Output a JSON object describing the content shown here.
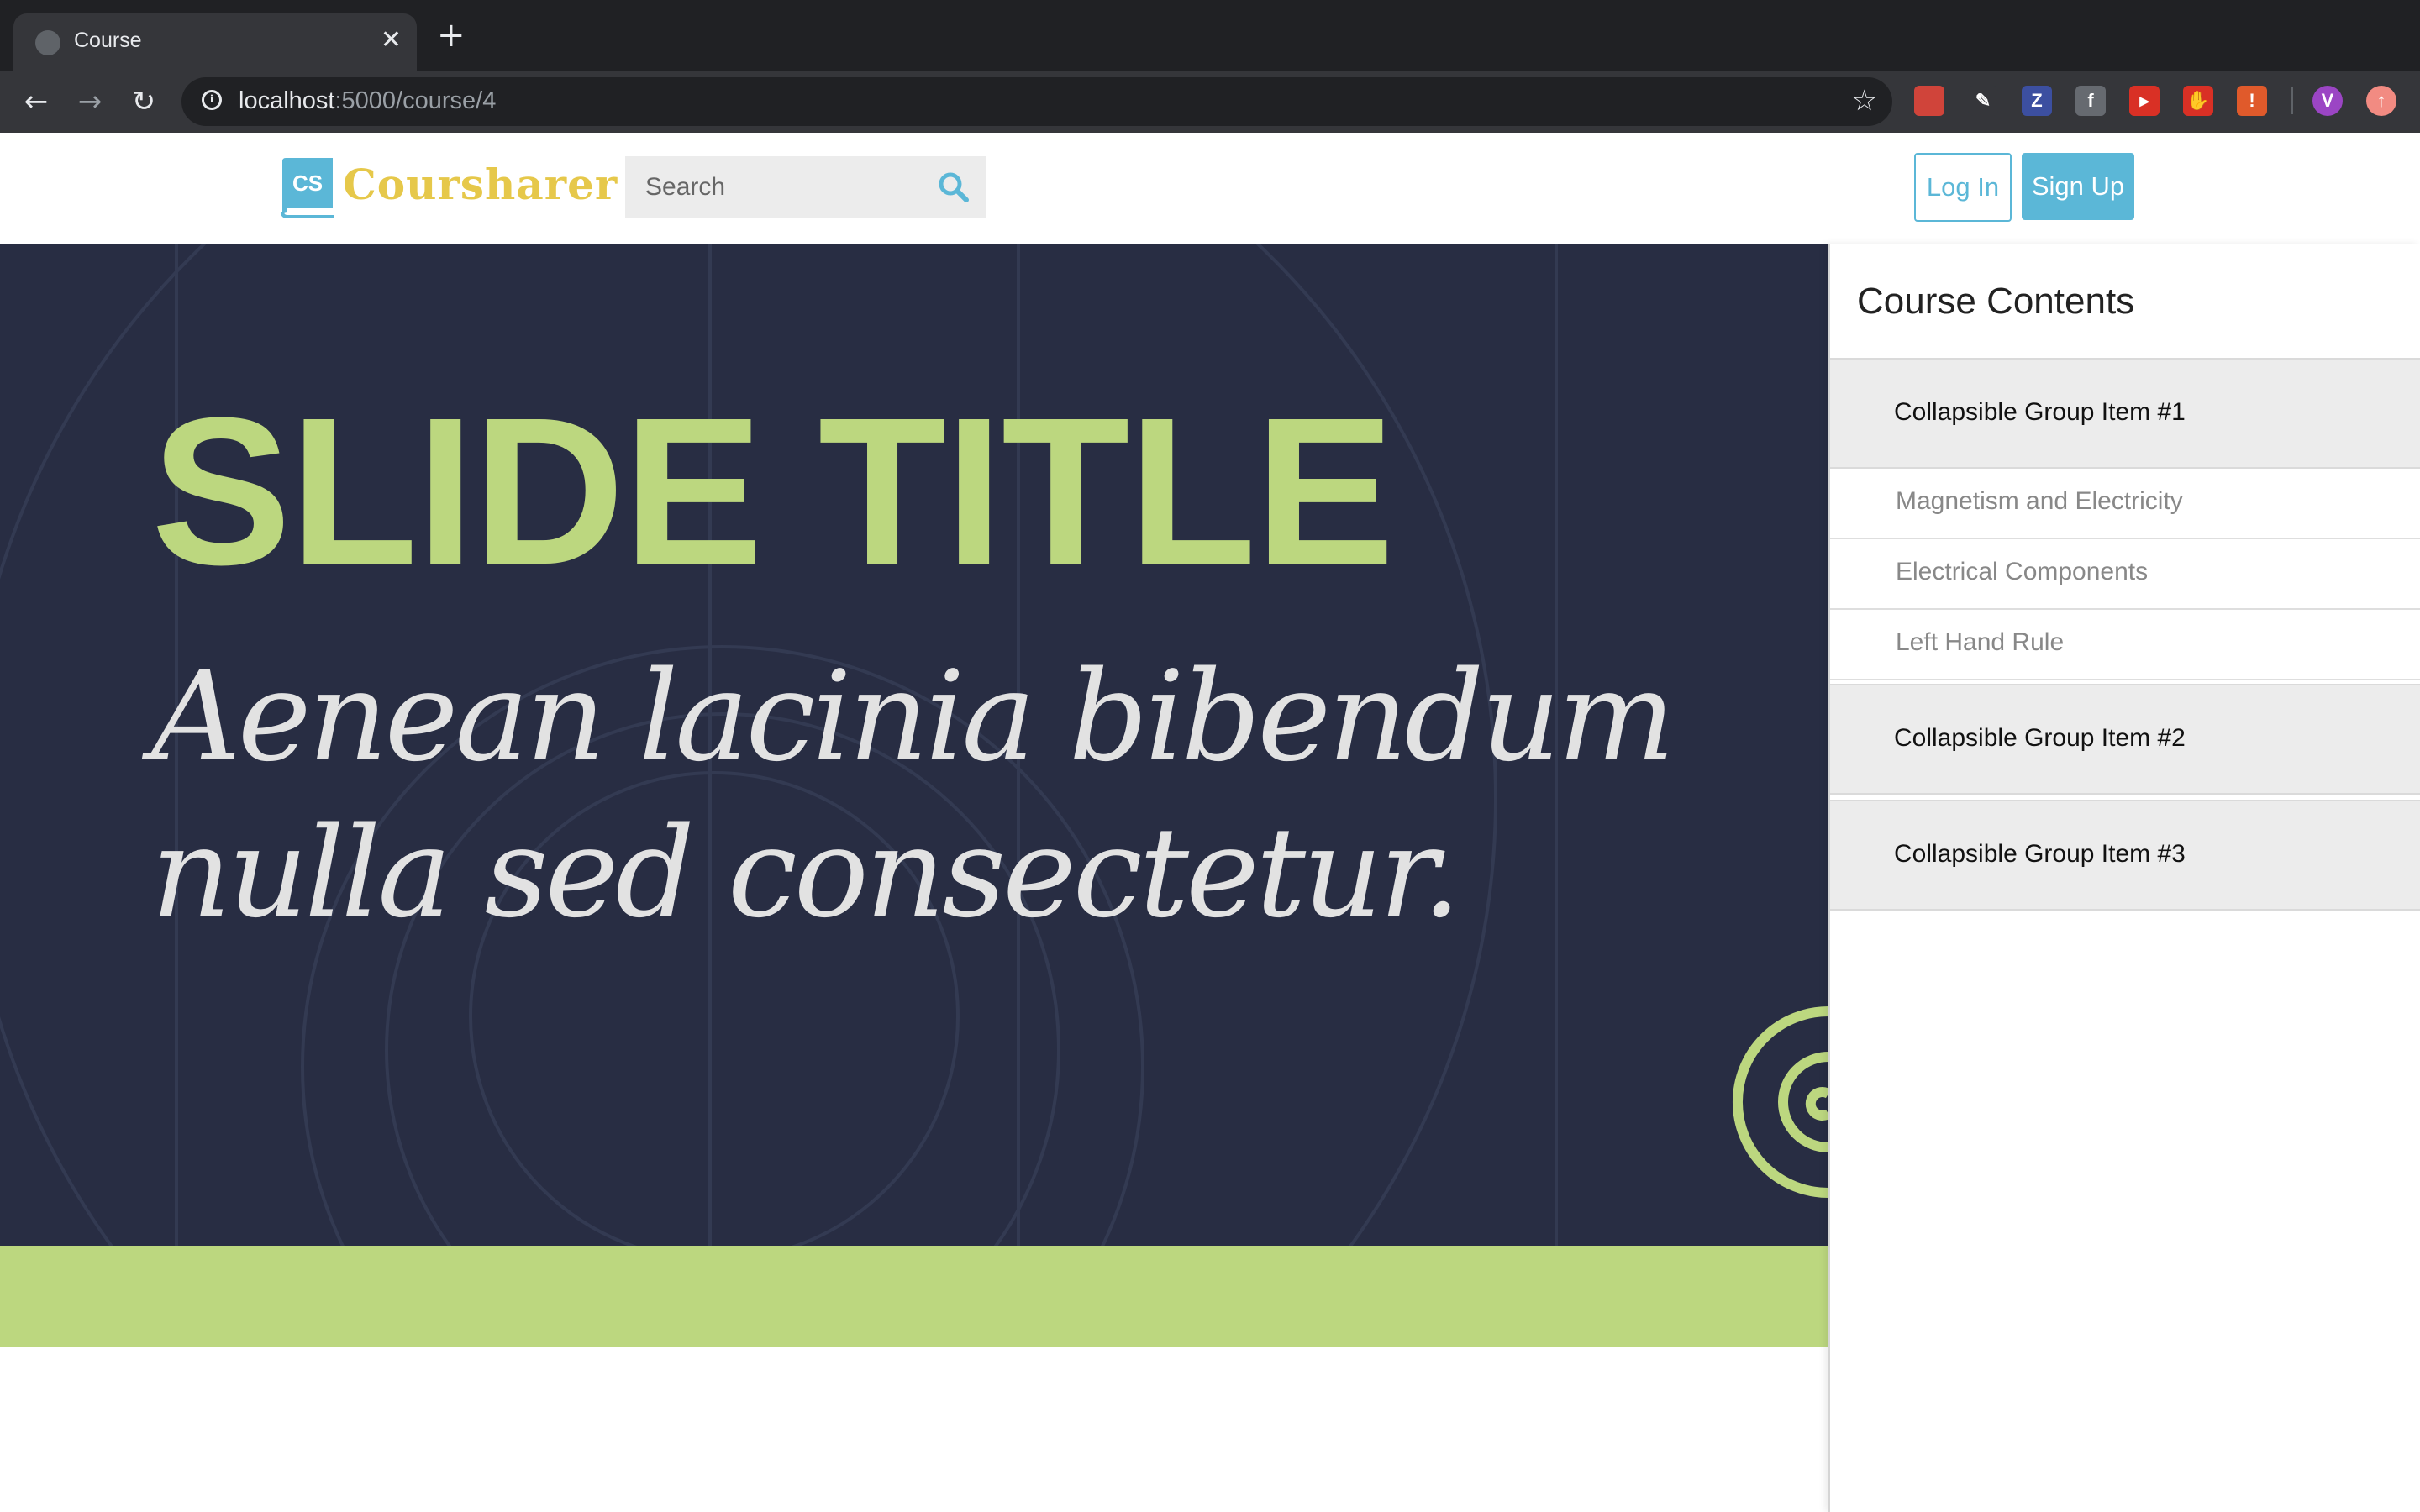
{
  "browser": {
    "tab_title": "Course",
    "tab_close": "✕",
    "new_tab": "+",
    "url_host": "localhost",
    "url_path": ":5000/course/4",
    "nav": {
      "back": "←",
      "forward": "→",
      "reload": "↻",
      "star": "☆"
    },
    "extensions": [
      {
        "icon": "pdf-extension-icon",
        "color": "#d0443a",
        "glyph": ""
      },
      {
        "icon": "highlighter-extension-icon",
        "color": "#35363a",
        "glyph": "✎"
      },
      {
        "icon": "zotero-extension-icon",
        "color": "#3c4fa0",
        "glyph": "Z"
      },
      {
        "icon": "facebook-extension-icon",
        "color": "#666a70",
        "glyph": "f"
      },
      {
        "icon": "youtube-extension-icon",
        "color": "#d93025",
        "glyph": "▸"
      },
      {
        "icon": "adblock-extension-icon",
        "color": "#d93025",
        "glyph": "✋"
      },
      {
        "icon": "alert-extension-icon",
        "color": "#e05a2b",
        "glyph": "!"
      },
      {
        "icon": "profile-avatar-icon",
        "color": "#9b45c4",
        "glyph": "V"
      },
      {
        "icon": "update-extension-icon",
        "color": "#f28b82",
        "glyph": "↑"
      }
    ]
  },
  "header": {
    "logo_mark": "CS",
    "logo_text": "Coursharer",
    "search_placeholder": "Search",
    "login_label": "Log In",
    "signup_label": "Sign Up"
  },
  "slide": {
    "title": "SLIDE TITLE",
    "body": "Aenean lacinia bibendum nulla sed consectetur.",
    "colors": {
      "background": "#282d43",
      "accent": "#bcd77f",
      "text": "#e2e2e2"
    }
  },
  "sidebar": {
    "title": "Course Contents",
    "groups": [
      {
        "label": "Collapsible Group Item #1",
        "items": [
          "Magnetism and Electricity",
          "Electrical Components",
          "Left Hand Rule"
        ]
      },
      {
        "label": "Collapsible Group Item #2"
      },
      {
        "label": "Collapsible Group Item #3"
      }
    ]
  },
  "colors": {
    "brand_blue": "#5bb7d7",
    "brand_yellow": "#e6c84a"
  }
}
